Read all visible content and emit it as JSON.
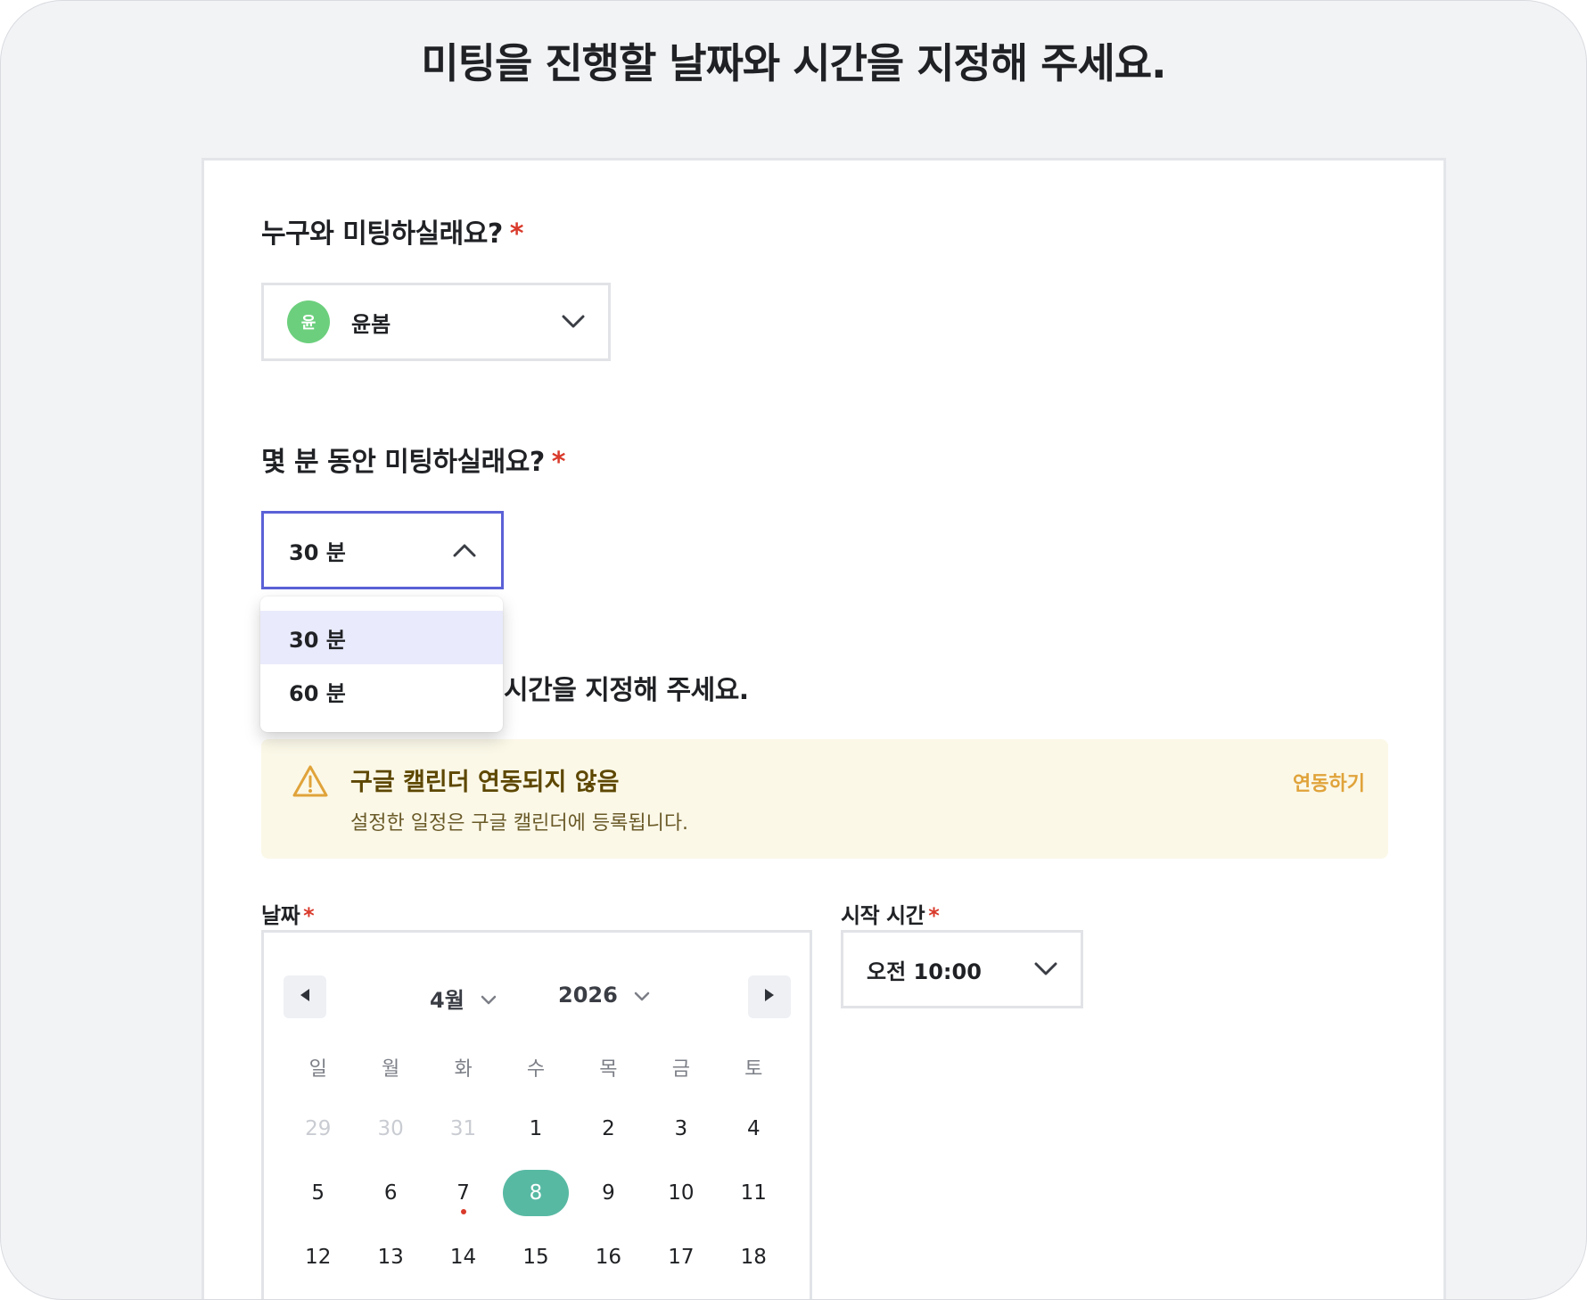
{
  "page": {
    "title": "미팅을 진행할 날짜와 시간을 지정해 주세요."
  },
  "who": {
    "label": "누구와 미팅하실래요?",
    "required": "*",
    "avatar_initial": "윤",
    "selected": "윤봄"
  },
  "duration": {
    "label": "몇 분 동안 미팅하실래요?",
    "required": "*",
    "selected": "30 분",
    "options": [
      "30 분",
      "60 분"
    ]
  },
  "schedule": {
    "label_visible_part": "시간을 지정해 주세요."
  },
  "banner": {
    "title": "구글 캘린더 연동되지 않음",
    "subtitle": "설정한 일정은 구글 캘린더에 등록됩니다.",
    "link": "연동하기",
    "accent": "#e0a33a"
  },
  "date": {
    "label": "날짜",
    "required": "*",
    "month": "4월",
    "year": "2026",
    "weekdays": [
      "일",
      "월",
      "화",
      "수",
      "목",
      "금",
      "토"
    ],
    "weeks": [
      [
        "29",
        "30",
        "31",
        "1",
        "2",
        "3",
        "4"
      ],
      [
        "5",
        "6",
        "7",
        "8",
        "9",
        "10",
        "11"
      ],
      [
        "12",
        "13",
        "14",
        "15",
        "16",
        "17",
        "18"
      ]
    ],
    "selected_day": "8",
    "marked_day": "7"
  },
  "start_time": {
    "label": "시작 시간",
    "required": "*",
    "selected": "오전 10:00"
  },
  "colors": {
    "selected_day": "#58b9a3",
    "required": "#d93a2b",
    "focus_border": "#5b61d6"
  }
}
